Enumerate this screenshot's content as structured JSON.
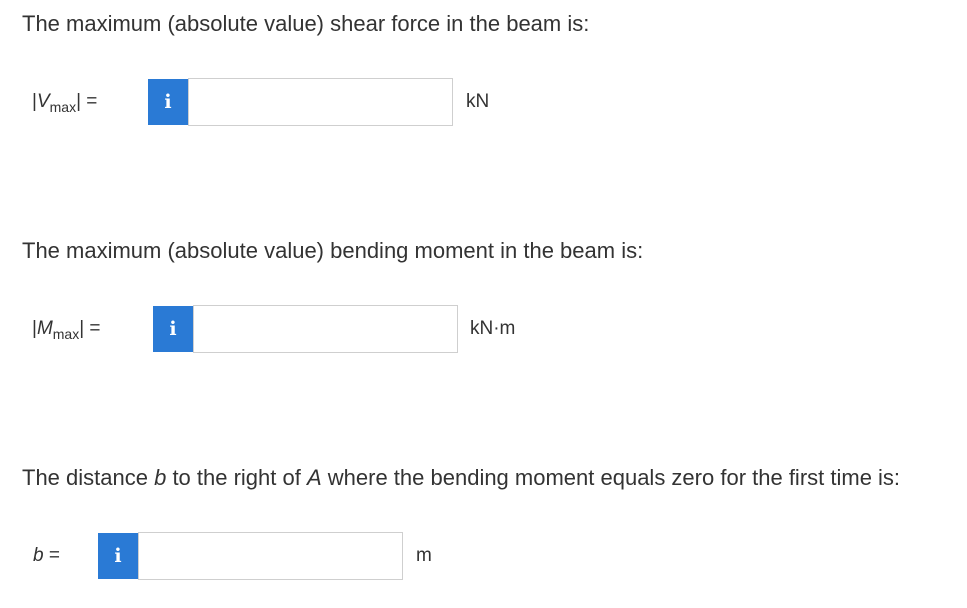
{
  "questions": [
    {
      "prompt": "The maximum (absolute value) shear force in the beam is:",
      "variable": {
        "pre": "|",
        "symbol": "V",
        "subscript": "max",
        "post": "| ="
      },
      "info_icon": "info-icon",
      "input": {
        "value": "",
        "placeholder": ""
      },
      "unit": "kN"
    },
    {
      "prompt": "The maximum (absolute value) bending moment in the beam is:",
      "variable": {
        "pre": "|",
        "symbol": "M",
        "subscript": "max",
        "post": "| ="
      },
      "info_icon": "info-icon",
      "input": {
        "value": "",
        "placeholder": ""
      },
      "unit": "kN·m"
    },
    {
      "prompt_parts": {
        "before_b": "The distance ",
        "b": "b",
        "mid": " to the right of ",
        "a": "A",
        "after": " where the bending moment equals zero for the first time is:"
      },
      "variable": {
        "symbol": "b",
        "post": " ="
      },
      "info_icon": "info-icon",
      "input": {
        "value": "",
        "placeholder": ""
      },
      "unit": "m"
    }
  ],
  "info_button_glyph": "i",
  "colors": {
    "info_button_bg": "#2a7ad5",
    "text": "#333333",
    "input_border": "#cfcfcf"
  }
}
